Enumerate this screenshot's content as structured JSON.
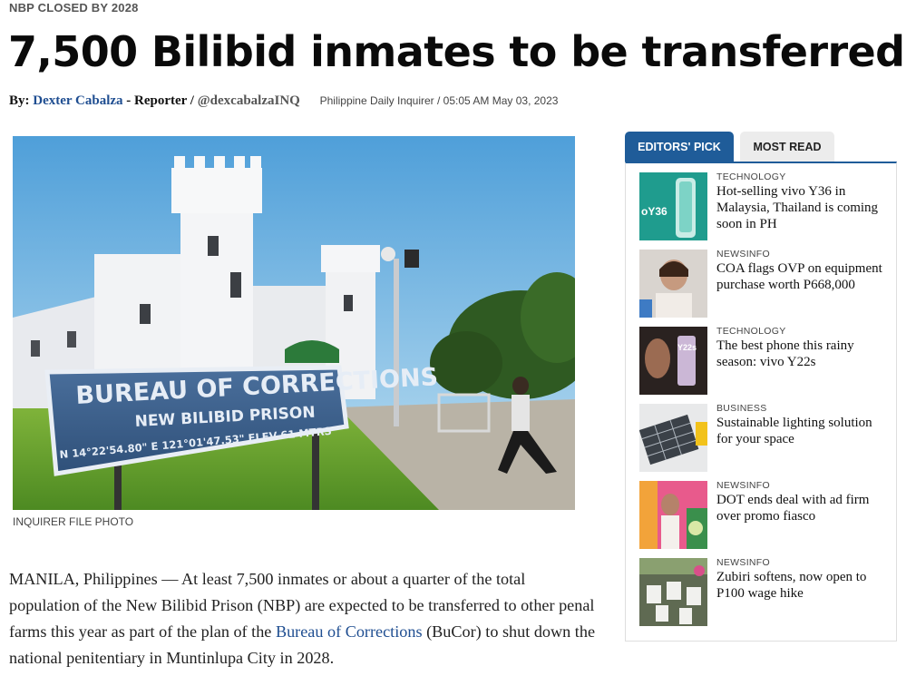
{
  "article": {
    "kicker": "NBP CLOSED BY 2028",
    "headline": "7,500 Bilibid inmates to be transferred",
    "byline": {
      "prefix": "By:",
      "author": "Dexter Cabalza",
      "role": "- Reporter /",
      "handle": "@dexcabalzaINQ",
      "meta": "Philippine Daily Inquirer / 05:05 AM May 03, 2023"
    },
    "photo": {
      "sign_line1": "BUREAU OF CORRECTIONS",
      "sign_line2": "NEW BILIBID PRISON",
      "sign_coords": "N 14°22'54.80\"  E 121°01'47.53\" ELEV 61 MTRS",
      "credit": "INQUIRER FILE PHOTO"
    },
    "body_part1": "MANILA, Philippines — At least 7,500 inmates or about a quarter of the total population of the New Bilibid Prison (NBP) are expected to be transferred to other penal farms this year as part of the plan of the ",
    "body_link": "Bureau of Corrections",
    "body_part2": " (BuCor) to shut down the national penitentiary in Muntinlupa City in 2028."
  },
  "sidebar": {
    "tabs": [
      {
        "label": "EDITORS' PICK",
        "active": true
      },
      {
        "label": "MOST READ",
        "active": false
      }
    ],
    "items": [
      {
        "category": "TECHNOLOGY",
        "title": "Hot-selling vivo Y36 in Malaysia, Thailand is coming soon in PH",
        "thumb_text": "oY36"
      },
      {
        "category": "NEWSINFO",
        "title": "COA flags OVP on equipment purchase worth P668,000",
        "thumb_text": ""
      },
      {
        "category": "TECHNOLOGY",
        "title": "The best phone this rainy season: vivo Y22s",
        "thumb_text": "Y22s"
      },
      {
        "category": "BUSINESS",
        "title": "Sustainable lighting solution for your space",
        "thumb_text": ""
      },
      {
        "category": "NEWSINFO",
        "title": "DOT ends deal with ad firm over promo fiasco",
        "thumb_text": ""
      },
      {
        "category": "NEWSINFO",
        "title": "Zubiri softens, now open to P100 wage hike",
        "thumb_text": ""
      }
    ]
  },
  "colors": {
    "accent": "#1f5c99",
    "link": "#1f4e91",
    "sign_blue": "#3b5f8c"
  }
}
